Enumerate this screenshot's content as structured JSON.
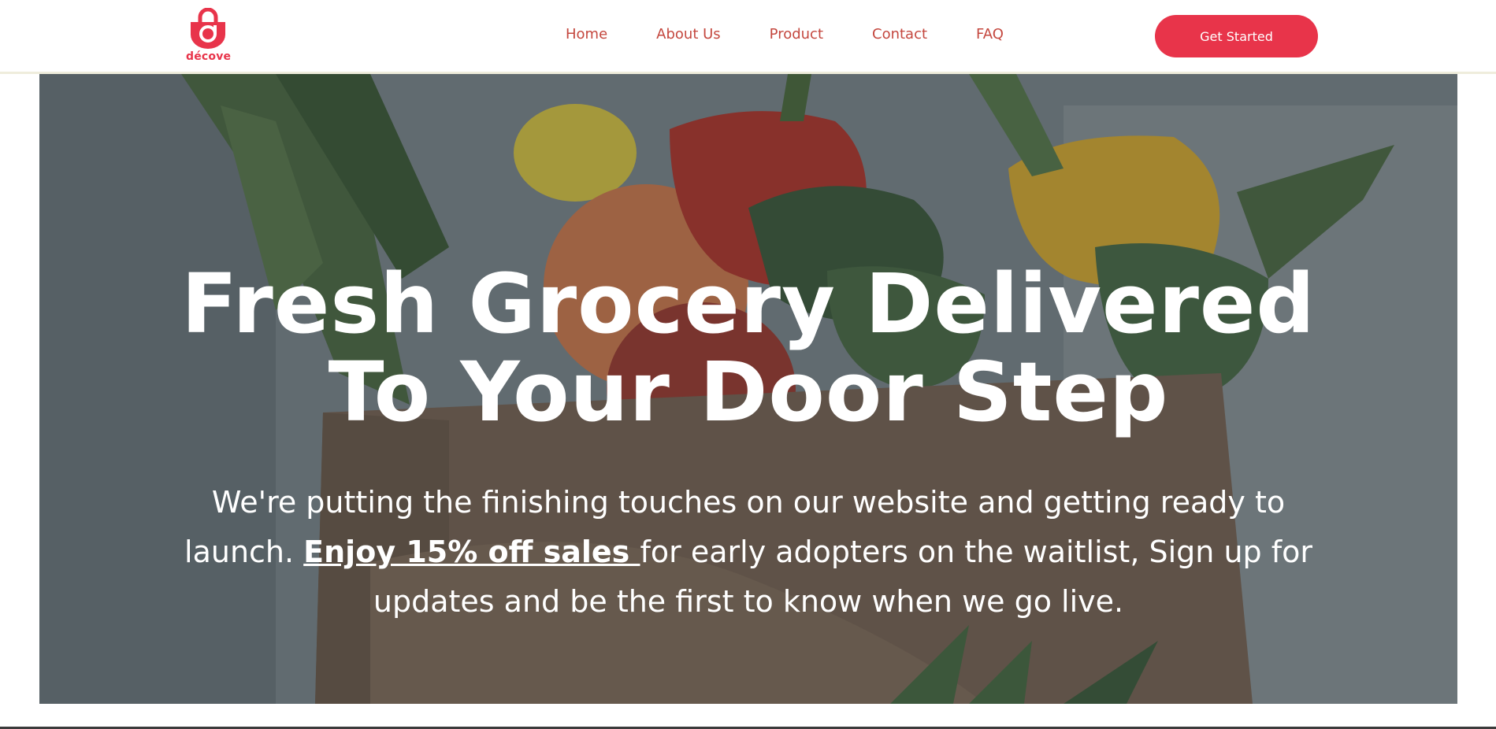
{
  "header": {
    "logo_text": "décove",
    "nav": [
      {
        "label": "Home"
      },
      {
        "label": "About Us"
      },
      {
        "label": "Product"
      },
      {
        "label": "Contact"
      },
      {
        "label": "FAQ"
      }
    ],
    "cta_label": "Get Started"
  },
  "hero": {
    "title_line1": "Fresh Grocery Delivered",
    "title_line2": "To Your Door Step",
    "subtitle_part1": "We're putting the finishing touches on our website and getting ready to launch. ",
    "subtitle_link": "Enjoy 15% off sales ",
    "subtitle_part2": "for early adopters on the waitlist, Sign up for updates and be the first to know when we go live."
  },
  "colors": {
    "brand": "#e8344a",
    "nav_text": "#c4473e",
    "header_border": "#efeddc"
  },
  "icons": {
    "logo": "shopping-bag-logo-icon"
  }
}
